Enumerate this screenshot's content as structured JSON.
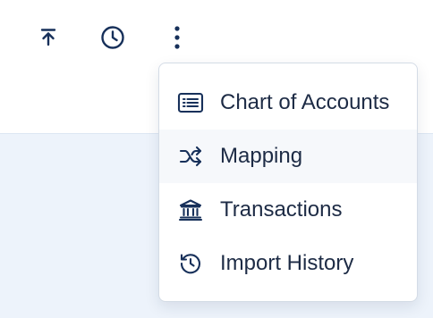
{
  "toolbar": {
    "buttons": [
      {
        "icon": "upload-icon"
      },
      {
        "icon": "clock-icon"
      },
      {
        "icon": "more-vertical-icon"
      }
    ]
  },
  "menu": {
    "items": [
      {
        "label": "Chart of Accounts",
        "icon": "list-icon"
      },
      {
        "label": "Mapping",
        "icon": "shuffle-icon",
        "active": true
      },
      {
        "label": "Transactions",
        "icon": "bank-icon"
      },
      {
        "label": "Import History",
        "icon": "history-icon"
      }
    ]
  },
  "colors": {
    "icon": "#17305a",
    "text": "#1d2b45",
    "background": "#edf3fb",
    "active_item": "#f6f8fb"
  }
}
